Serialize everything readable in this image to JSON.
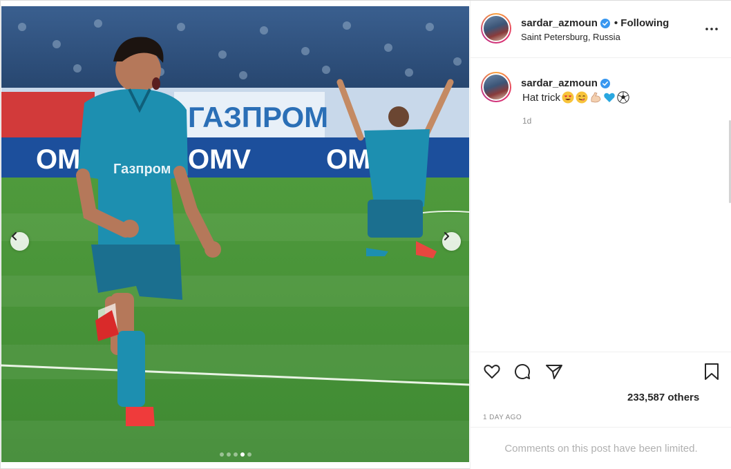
{
  "post": {
    "username": "sardar_azmoun",
    "verified": true,
    "follow_status": "• Following",
    "location": "Saint Petersburg, Russia",
    "more_icon": "more-options-icon"
  },
  "media": {
    "sponsor_text_1": "ГАЗПРОМ",
    "sponsor_text_2": "OMV",
    "shirt_sponsor": "Газпром",
    "carousel": {
      "slide_count": 5,
      "active_index": 3
    }
  },
  "caption": {
    "username": "sardar_azmoun",
    "text": "Hat trick",
    "emojis": [
      "heart-eyes-emoji",
      "yum-face-emoji",
      "flexed-biceps-emoji",
      "blue-heart-emoji",
      "soccer-ball-emoji"
    ],
    "time": "1d"
  },
  "actions": {
    "likes": "233,587 others",
    "time_ago": "1 DAY AGO"
  },
  "comments": {
    "notice": "Comments on this post have been limited."
  },
  "colors": {
    "verified_blue": "#3897f0",
    "secondary_text": "#8e8e8e",
    "border": "#dbdbdb"
  }
}
